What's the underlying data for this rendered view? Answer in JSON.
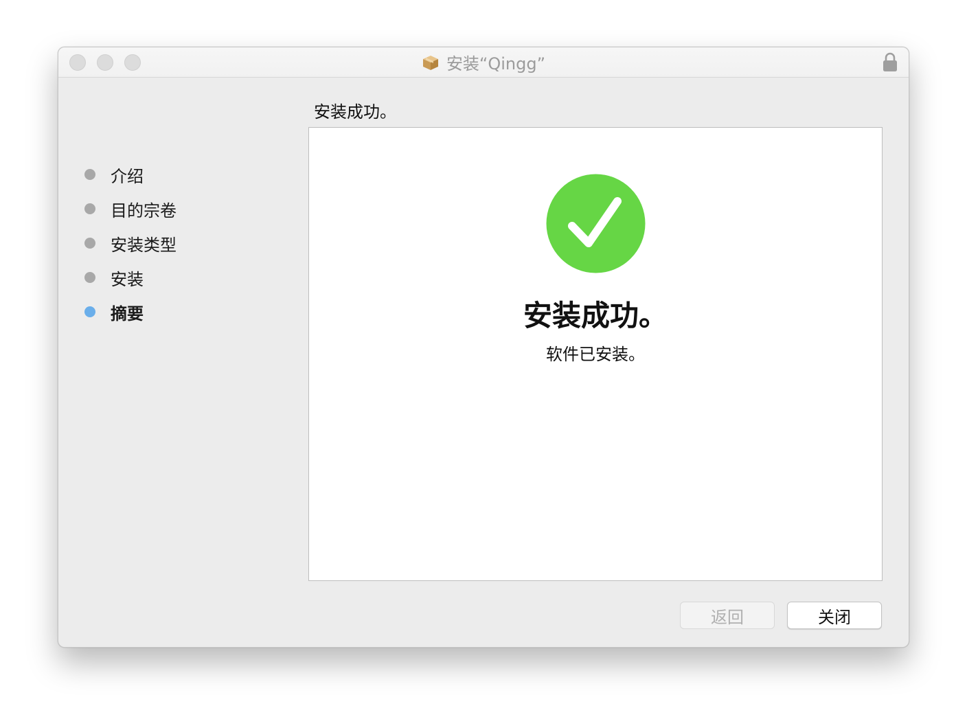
{
  "window": {
    "title": "安装“Qingg”"
  },
  "sidebar": {
    "steps": [
      {
        "label": "介绍",
        "state": "done"
      },
      {
        "label": "目的宗卷",
        "state": "done"
      },
      {
        "label": "安装类型",
        "state": "done"
      },
      {
        "label": "安装",
        "state": "done"
      },
      {
        "label": "摘要",
        "state": "active"
      }
    ]
  },
  "content": {
    "heading": "安装成功。",
    "success_title": "安装成功。",
    "success_subtitle": "软件已安装。"
  },
  "buttons": {
    "back_label": "返回",
    "close_label": "关闭"
  },
  "colors": {
    "success_green": "#66d645",
    "active_dot": "#6aaeea",
    "inactive_dot": "#a8a8a8"
  },
  "icons": {
    "title_icon": "package-icon",
    "lock_icon": "lock-icon",
    "status_icon": "checkmark-circle-icon"
  }
}
